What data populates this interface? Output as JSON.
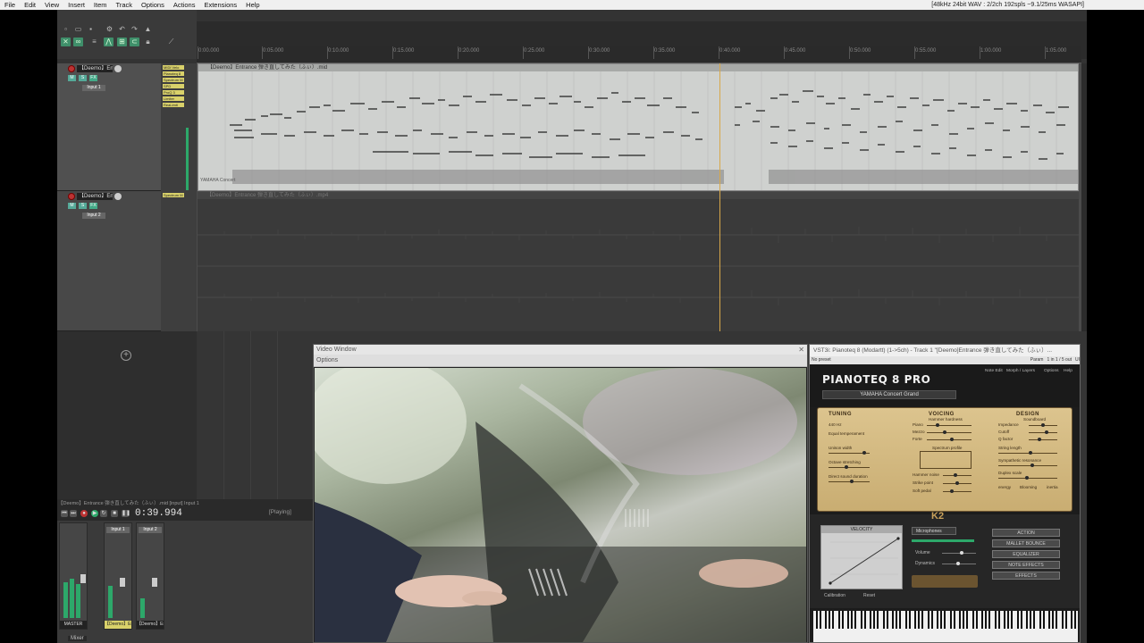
{
  "menu": {
    "items": [
      "File",
      "Edit",
      "View",
      "Insert",
      "Item",
      "Track",
      "Options",
      "Actions",
      "Extensions",
      "Help"
    ],
    "status": "[48kHz 24bit WAV : 2/2ch 192spls ~9.1/25ms WASAPI]"
  },
  "ruler": {
    "ticks": [
      "0:00.000",
      "0:05.000",
      "0:10.000",
      "0:15.000",
      "0:20.000",
      "0:25.000",
      "0:30.000",
      "0:35.000",
      "0:40.000",
      "0:45.000",
      "0:50.000",
      "0:55.000",
      "1:00.000",
      "1:05.000"
    ]
  },
  "tracks": [
    {
      "name": "【Deemo】Entr",
      "fx": [
        "MIDI Velo",
        "Pianoteq 8",
        "Spectrum M",
        "SPD",
        "ProQ 3",
        "Limiter",
        "ReaLimit"
      ]
    },
    {
      "name": "【Deemo】Entr",
      "fx": [
        "Spectrum M"
      ]
    }
  ],
  "items": {
    "midi_label": "【Deemo】Entrance 弾き直してみた（ふぃ）.mid",
    "midi_sublabel": "YAMAHA Concert",
    "audio_label": "【Deemo】Entrance 弾き直してみた（ふぃ）.mp4"
  },
  "transport": {
    "title": "【Deemo】Entrance 弾き直してみた（ふぃ）.mid  [input] Input 1",
    "time": "0:39.994",
    "state": "[Playing]"
  },
  "mixer": {
    "tab": "Mixer",
    "master_label": "MASTER",
    "strips": [
      "【Deemo】Ent",
      "【Deemo】Ent"
    ],
    "input_labels": [
      "Input 1",
      "Input 2"
    ]
  },
  "video": {
    "title": "Video Window",
    "options": "Options"
  },
  "plugin": {
    "title": "VST3i: Pianoteq 8 (Modartt) (1->5ch) - Track 1 \"[Deemo]Entrance 弾き直してみた（ふぃ）...",
    "bar": [
      "No preset",
      "Param",
      "1 in 1 / 5 out",
      "UI"
    ],
    "logo": "PIANOTEQ 8 PRO",
    "preset": "YAMAHA Concert Grand",
    "tabs": [
      "Note Edit",
      "Morph / Layers",
      "Options",
      "Help"
    ],
    "sections": [
      "TUNING",
      "VOICING",
      "DESIGN"
    ],
    "tuning": [
      "440 Hz",
      "Equal temperament",
      "Unison width",
      "Octave stretching",
      "Direct sound duration"
    ],
    "voicing": [
      "Hammer hardness",
      "Piano",
      "Mezzo",
      "Forte",
      "Spectrum profile",
      "Hammer noise",
      "Strike point",
      "Soft pedal"
    ],
    "design": [
      "Soundboard",
      "Impedance",
      "Cutoff",
      "Q factor",
      "String length",
      "Sympathetic resonance",
      "Duplex scale",
      "Blooming",
      "energy",
      "inertia"
    ],
    "velocity": "VELOCITY",
    "calibration": "Calibration",
    "reset": "Reset",
    "microphones": "Microphones",
    "volume": "Volume",
    "dynamics": "Dynamics",
    "buttons": [
      "ACTION",
      "MALLET BOUNCE",
      "EQUALIZER",
      "NOTE EFFECTS",
      "EFFECTS"
    ]
  },
  "colors": {
    "accent": "#2da86a",
    "playcursor": "#d8a84a",
    "panel": "#dcc48e"
  }
}
